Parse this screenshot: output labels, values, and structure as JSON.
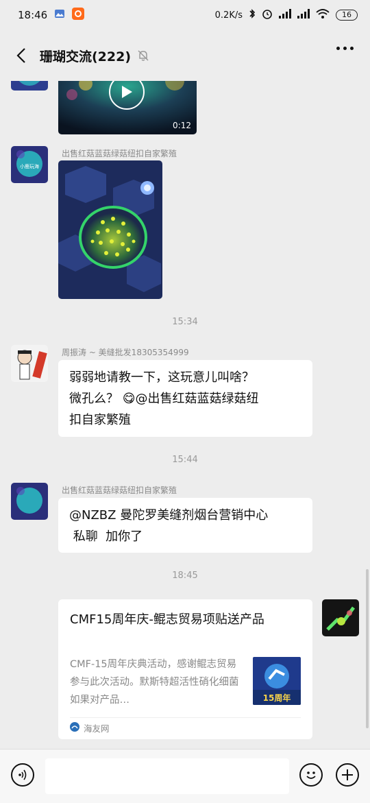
{
  "status_bar": {
    "time": "18:46",
    "net_speed": "0.2K/s",
    "battery": "16"
  },
  "nav": {
    "title": "珊瑚交流(222)"
  },
  "messages": {
    "video_duration": "0:12",
    "msg1_sender": "出售红菇蓝菇绿菇纽扣自家繁殖",
    "time1": "15:34",
    "msg2_sender": "周振涛 ~ 美缝批发18305354999",
    "msg2_text1": "弱弱地请教一下，这玩意儿叫啥？",
    "msg2_text2": "微孔么？",
    "msg2_emoji": "😋",
    "msg2_text3": "@出售红菇蓝菇绿菇纽",
    "msg2_text4": "扣自家繁殖",
    "time2": "15:44",
    "msg3_sender": "出售红菇蓝菇绿菇纽扣自家繁殖",
    "msg3_line1": "@NZBZ 曼陀罗美缝剂烟台营销中心",
    "msg3_line2": " 私聊  加你了",
    "time3": "18:45"
  },
  "link_card": {
    "title": "CMF15周年庆-鲲志贸易项贴送产品",
    "description": "CMF-15周年庆典活动，感谢鲲志贸易参与此次活动。默斯特超活性硝化细菌如果对产品…",
    "thumb_text": "15周年",
    "source": "海友网"
  },
  "avatars": {
    "coral_label": "小鹿玩海"
  },
  "colors": {
    "background": "#ededed",
    "bubble": "#ffffff",
    "meta_text": "#999999"
  }
}
